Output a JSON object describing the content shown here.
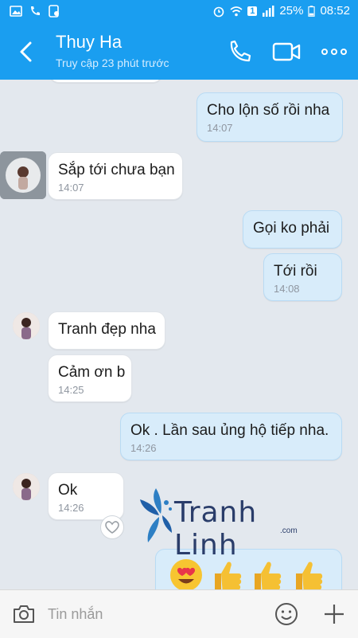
{
  "status": {
    "battery": "25%",
    "time": "08:52",
    "sim": "1"
  },
  "header": {
    "contact_name": "Thuy Ha",
    "last_seen": "Truy cập 23 phút trước"
  },
  "messages": [
    {
      "dir": "out",
      "text": "Cho lộn số rồi nha",
      "time": "14:07"
    },
    {
      "dir": "in",
      "text": "Sắp tới chưa bạn",
      "time": "14:07"
    },
    {
      "dir": "out",
      "text": "Gọi ko phải",
      "time": ""
    },
    {
      "dir": "out",
      "text": "Tới rồi",
      "time": "14:08"
    },
    {
      "dir": "in",
      "text": "Tranh đẹp nha",
      "time": ""
    },
    {
      "dir": "in",
      "text": "Cảm ơn b",
      "time": "14:25"
    },
    {
      "dir": "out",
      "text": "Ok . Lần sau ủng hộ tiếp nha.",
      "time": "14:26"
    },
    {
      "dir": "in",
      "text": "Ok",
      "time": "14:26"
    }
  ],
  "emoji_message": {
    "icons": [
      "heart-eyes-emoji",
      "thumbs-up-emoji",
      "thumbs-up-emoji",
      "thumbs-up-emoji"
    ]
  },
  "composer": {
    "placeholder": "Tin nhắn"
  },
  "watermark": {
    "brand": "Tranh Linh",
    "suffix": ".com"
  },
  "colors": {
    "header": "#1a9ef0",
    "outgoing": "#d8ecfa",
    "incoming": "#ffffff",
    "background": "#e3e8ee"
  }
}
